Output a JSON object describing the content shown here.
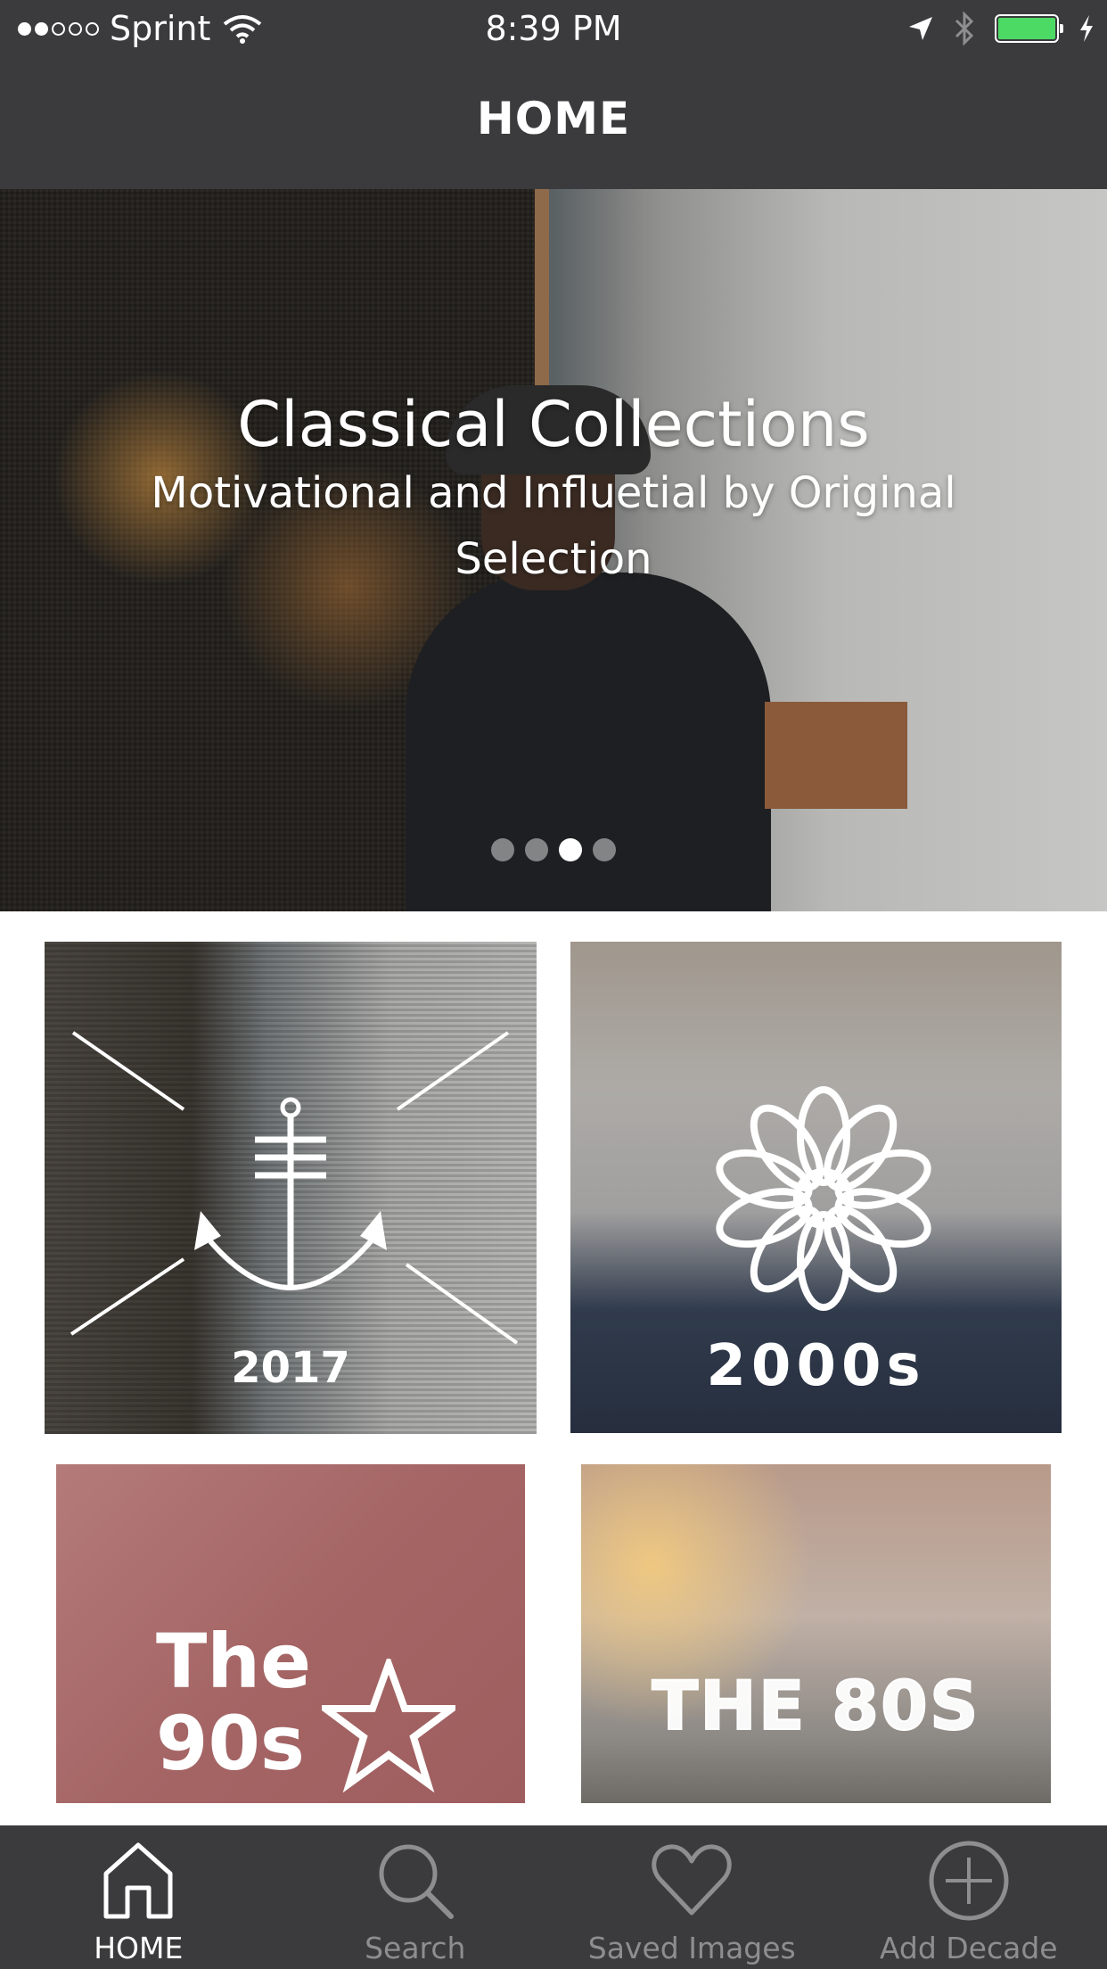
{
  "status_bar": {
    "carrier": "Sprint",
    "time": "8:39 PM"
  },
  "nav": {
    "title": "HOME"
  },
  "hero": {
    "title": "Classical Collections",
    "subtitle": "Motivational and Influetial by Original Selection",
    "page_count": 4,
    "active_page": 3
  },
  "tiles": [
    {
      "label": "2017"
    },
    {
      "label": "2000s"
    },
    {
      "label": "The 90s"
    },
    {
      "label": "THE 80S"
    }
  ],
  "tabbar": {
    "items": [
      {
        "label": "HOME",
        "icon": "home-icon",
        "active": true
      },
      {
        "label": "Search",
        "icon": "search-icon",
        "active": false
      },
      {
        "label": "Saved Images",
        "icon": "heart-icon",
        "active": false
      },
      {
        "label": "Add Decade",
        "icon": "add-circle-icon",
        "active": false
      }
    ]
  },
  "colors": {
    "bar_background": "#3b3b3d",
    "battery": "#4cd964",
    "tab_active": "#ffffff",
    "tab_inactive": "#8e8e90"
  }
}
